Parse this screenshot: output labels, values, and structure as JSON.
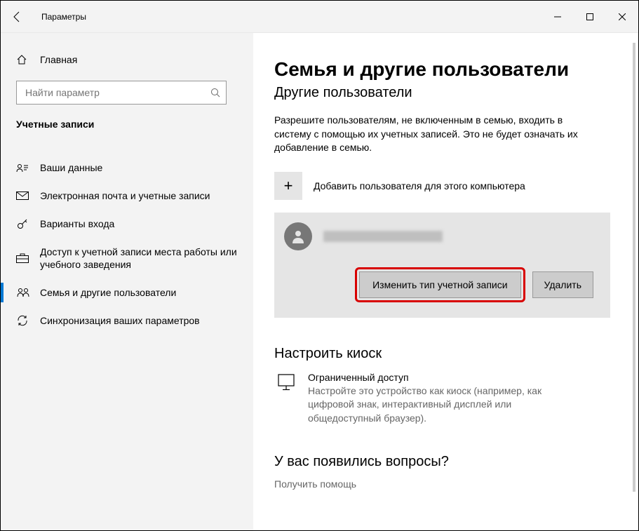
{
  "titlebar": {
    "title": "Параметры"
  },
  "sidebar": {
    "home": "Главная",
    "search_placeholder": "Найти параметр",
    "category": "Учетные записи",
    "items": [
      {
        "icon": "person-card",
        "label": "Ваши данные"
      },
      {
        "icon": "mail",
        "label": "Электронная почта и учетные записи"
      },
      {
        "icon": "key",
        "label": "Варианты входа"
      },
      {
        "icon": "briefcase",
        "label": "Доступ к учетной записи места работы или учебного заведения"
      },
      {
        "icon": "family",
        "label": "Семья и другие пользователи"
      },
      {
        "icon": "sync",
        "label": "Синхронизация ваших параметров"
      }
    ]
  },
  "content": {
    "heading": "Семья и другие пользователи",
    "subheading": "Другие пользователи",
    "description": "Разрешите пользователям, не включенным в семью, входить в систему с помощью их учетных записей. Это не будет означать их добавление в семью.",
    "add_user": "Добавить пользователя для этого компьютера",
    "btn_change": "Изменить тип учетной записи",
    "btn_delete": "Удалить",
    "kiosk_heading": "Настроить киоск",
    "kiosk_title": "Ограниченный доступ",
    "kiosk_desc": "Настройте это устройство как киоск (например, как цифровой знак, интерактивный дисплей или общедоступный браузер).",
    "help_heading": "У вас появились вопросы?",
    "help_link": "Получить помощь"
  }
}
